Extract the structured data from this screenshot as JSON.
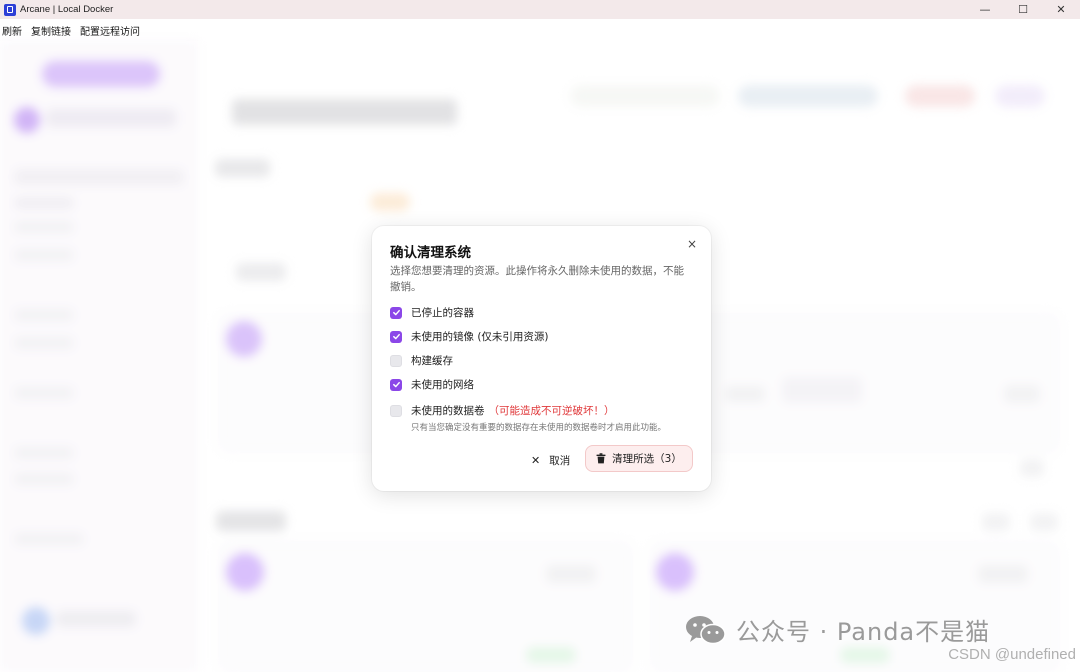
{
  "window": {
    "title": "Arcane | Local Docker",
    "minimize": "—",
    "maximize": "☐",
    "close": "✕"
  },
  "menu": [
    "刷新",
    "复制链接",
    "配置远程访问"
  ],
  "dialog": {
    "title": "确认清理系统",
    "description": "选择您想要清理的资源。此操作将永久删除未使用的数据，不能撤销。",
    "close": "×",
    "options": [
      {
        "label": "已停止的容器",
        "checked": true
      },
      {
        "label": "未使用的镜像 (仅未引用资源)",
        "checked": true
      },
      {
        "label": "构建缓存",
        "checked": false
      },
      {
        "label": "未使用的网络",
        "checked": true
      },
      {
        "label": "未使用的数据卷",
        "checked": false,
        "warning": "（可能造成不可逆破坏！）"
      }
    ],
    "volume_hint": "只有当您确定没有重要的数据存在未使用的数据卷时才启用此功能。",
    "cancel_label": "取消",
    "confirm_label": "清理所选（3）"
  },
  "colors": {
    "accent": "#8b47e8",
    "warning": "#e0393b",
    "danger_bg": "#fdeeee"
  },
  "watermark": {
    "wechat": "公众号 · Panda不是猫",
    "csdn": "CSDN @undefined"
  }
}
